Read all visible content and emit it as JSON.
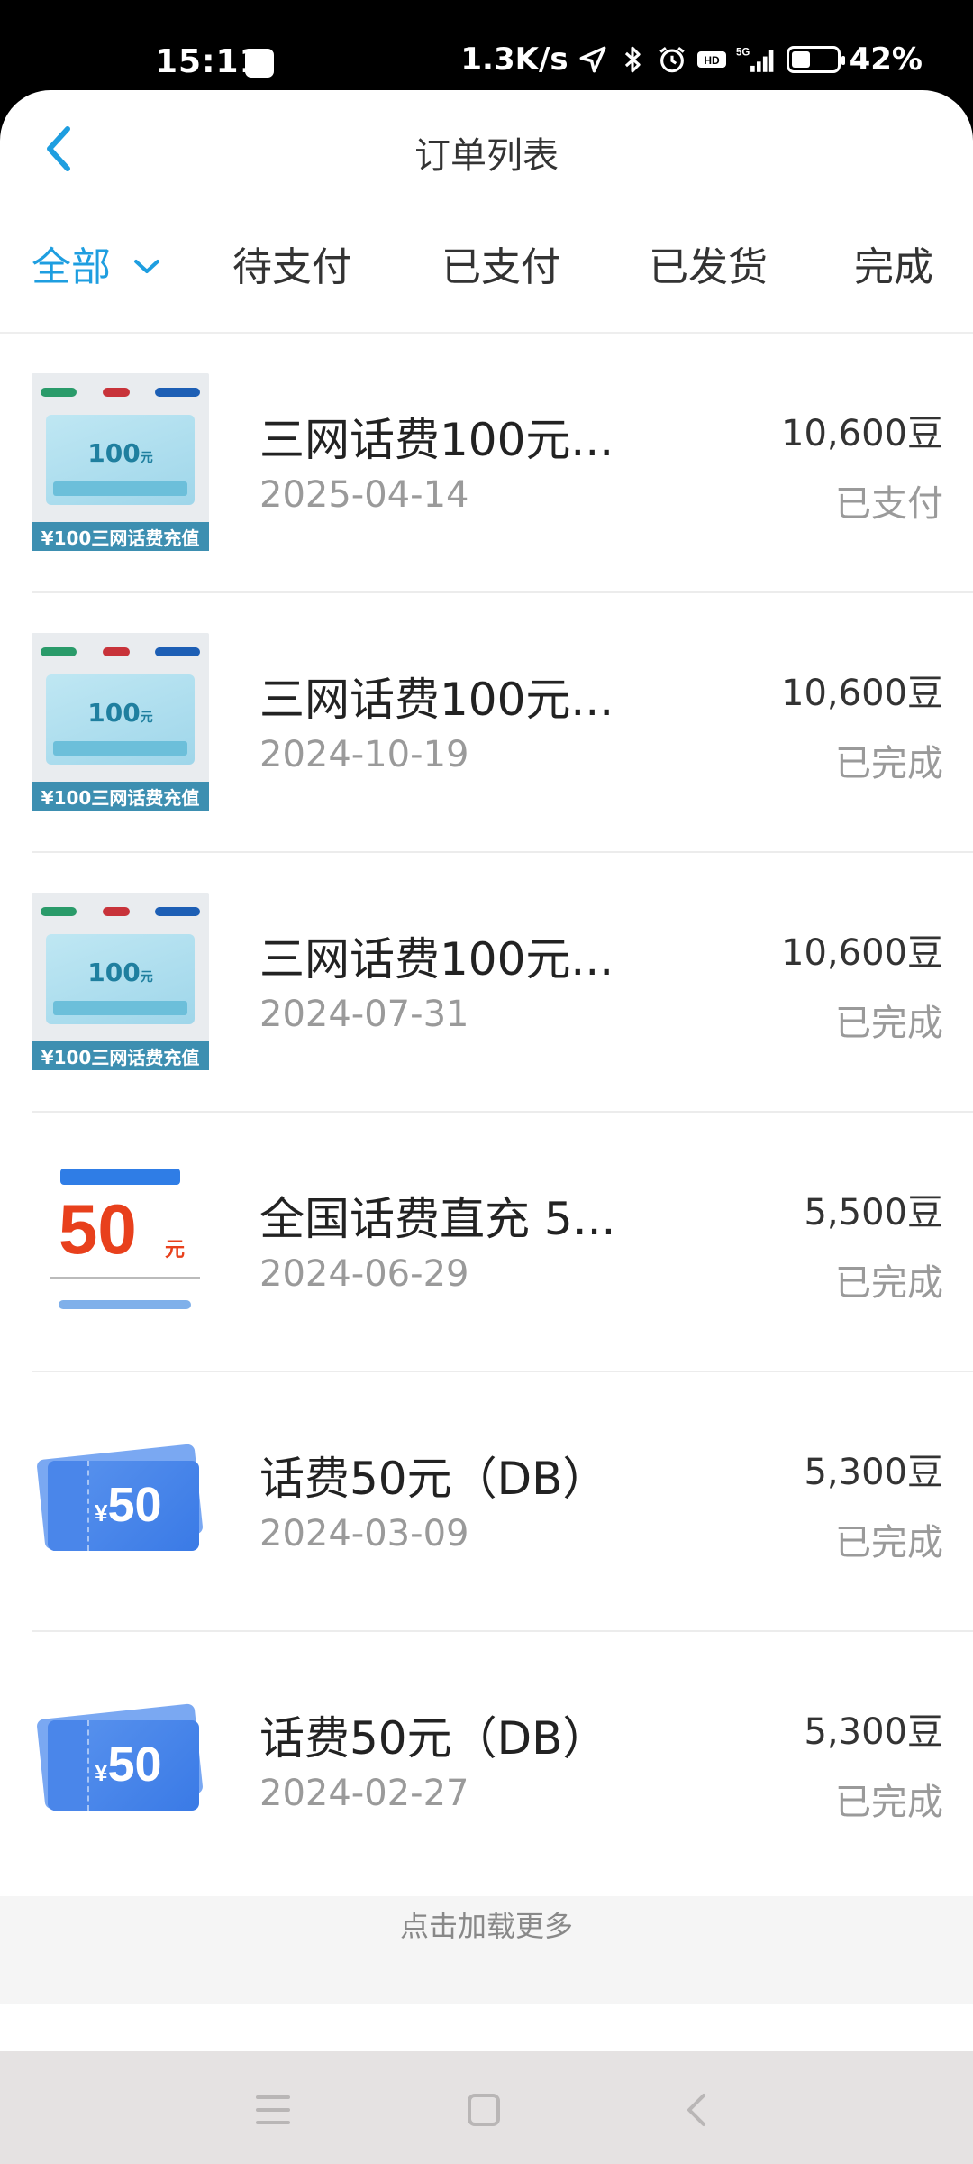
{
  "status_bar": {
    "time": "15:11",
    "speed": "1.3K/s",
    "network": "5G",
    "hd": "HD",
    "battery_percent": "42%",
    "battery_level": 0.42,
    "icons": [
      "location-arrow-icon",
      "bluetooth-icon",
      "alarm-icon",
      "hd-icon",
      "signal-icon",
      "battery-icon"
    ]
  },
  "header": {
    "title": "订单列表",
    "back_icon": "chevron-left-icon"
  },
  "tabs": [
    {
      "label": "全部",
      "active": true
    },
    {
      "label": "待支付"
    },
    {
      "label": "已支付"
    },
    {
      "label": "已发货"
    },
    {
      "label": "完成"
    }
  ],
  "orders": [
    {
      "title": "三网话费100元...",
      "date": "2025-04-14",
      "price": "10,600豆",
      "status": "已支付",
      "thumb": {
        "amount": "100",
        "unit": "元",
        "caption": "¥100三网话费充值"
      }
    },
    {
      "title": "三网话费100元...",
      "date": "2024-10-19",
      "price": "10,600豆",
      "status": "已完成",
      "thumb": {
        "amount": "100",
        "unit": "元",
        "caption": "¥100三网话费充值"
      }
    },
    {
      "title": "三网话费100元...",
      "date": "2024-07-31",
      "price": "10,600豆",
      "status": "已完成",
      "thumb": {
        "amount": "100",
        "unit": "元",
        "caption": "¥100三网话费充值"
      }
    },
    {
      "title": "全国话费直充 5...",
      "date": "2024-06-29",
      "price": "5,500豆",
      "status": "已完成",
      "thumb": {
        "amount": "50",
        "unit": "元"
      }
    },
    {
      "title": "话费50元（DB）",
      "date": "2024-03-09",
      "price": "5,300豆",
      "status": "已完成",
      "thumb": {
        "currency": "¥",
        "amount": "50"
      }
    },
    {
      "title": "话费50元（DB）",
      "date": "2024-02-27",
      "price": "5,300豆",
      "status": "已完成",
      "thumb": {
        "currency": "¥",
        "amount": "50"
      }
    }
  ],
  "load_more": "点击加载更多",
  "accent_color": "#1e9ee0"
}
